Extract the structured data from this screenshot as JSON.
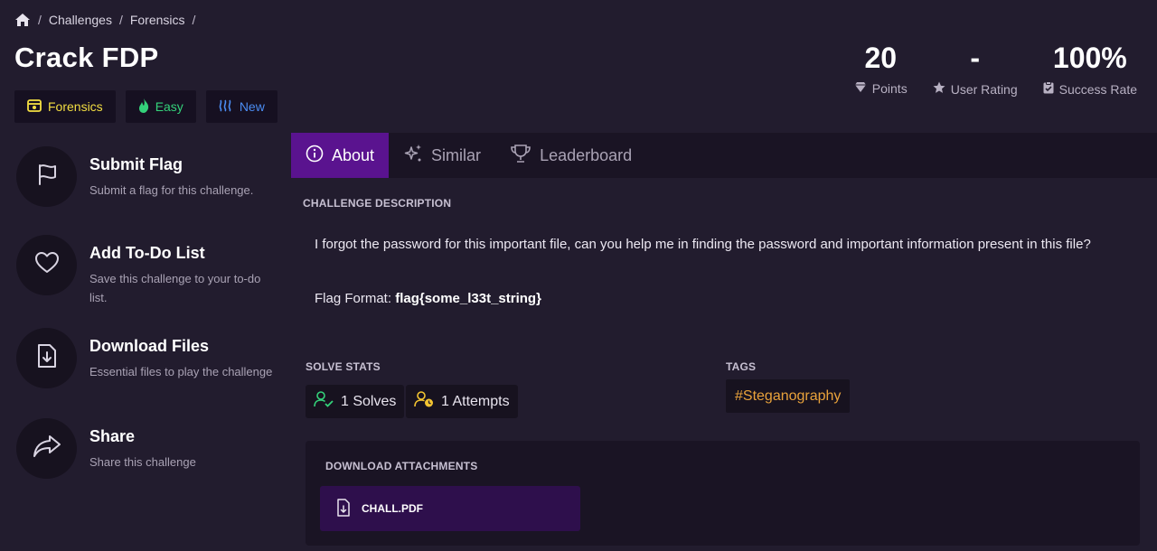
{
  "breadcrumb": {
    "items": [
      "Challenges",
      "Forensics"
    ],
    "separator": "/"
  },
  "title": "Crack FDP",
  "badges": {
    "category": "Forensics",
    "difficulty": "Easy",
    "status": "New"
  },
  "stats": {
    "points_value": "20",
    "points_label": "Points",
    "rating_value": "-",
    "rating_label": "User Rating",
    "success_value": "100%",
    "success_label": "Success Rate"
  },
  "actions": [
    {
      "title": "Submit Flag",
      "desc": "Submit a flag for this challenge.",
      "icon": "flag-icon"
    },
    {
      "title": "Add To-Do List",
      "desc": "Save this challenge to your to-do list.",
      "icon": "heart-icon"
    },
    {
      "title": "Download Files",
      "desc": "Essential files to play the challenge",
      "icon": "download-file-icon"
    },
    {
      "title": "Share",
      "desc": "Share this challenge",
      "icon": "share-icon"
    }
  ],
  "tabs": {
    "about": "About",
    "similar": "Similar",
    "leaderboard": "Leaderboard"
  },
  "description": {
    "label": "CHALLENGE DESCRIPTION",
    "text": "I forgot the password for this important file, can you help me in finding the password and important information present in this file?",
    "flag_prefix": "Flag Format:",
    "flag_format": "flag{some_l33t_string}"
  },
  "solve_stats": {
    "label": "SOLVE STATS",
    "solves": "1 Solves",
    "attempts": "1 Attempts"
  },
  "tags": {
    "label": "TAGS",
    "items": [
      "#Steganography"
    ]
  },
  "attachments": {
    "label": "DOWNLOAD ATTACHMENTS",
    "file": "CHALL.PDF"
  },
  "colors": {
    "background": "#221c2e",
    "accent": "#5a138f",
    "category": "#f4df42",
    "difficulty": "#34d27a",
    "status": "#4b8df3",
    "tag": "#e9a23b"
  }
}
